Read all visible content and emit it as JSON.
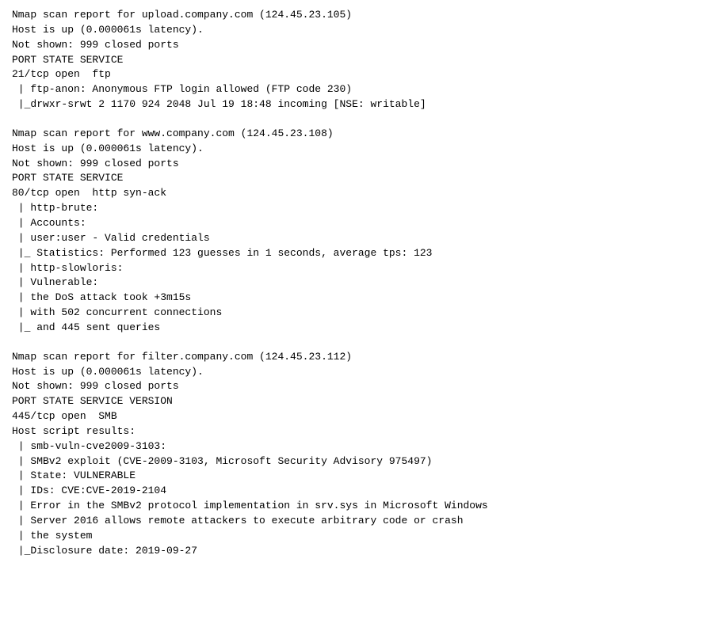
{
  "sections": [
    {
      "id": "section1",
      "lines": [
        "Nmap scan report for upload.company.com (124.45.23.105)",
        "Host is up (0.000061s latency).",
        "Not shown: 999 closed ports",
        "PORT STATE SERVICE",
        "21/tcp open  ftp",
        " | ftp-anon: Anonymous FTP login allowed (FTP code 230)",
        " |_drwxr-srwt 2 1170 924 2048 Jul 19 18:48 incoming [NSE: writable]"
      ]
    },
    {
      "id": "section2",
      "lines": [
        "Nmap scan report for www.company.com (124.45.23.108)",
        "Host is up (0.000061s latency).",
        "Not shown: 999 closed ports",
        "PORT STATE SERVICE",
        "80/tcp open  http syn-ack",
        " | http-brute:",
        " | Accounts:",
        " | user:user - Valid credentials",
        " |_ Statistics: Performed 123 guesses in 1 seconds, average tps: 123",
        " | http-slowloris:",
        " | Vulnerable:",
        " | the DoS attack took +3m15s",
        " | with 502 concurrent connections",
        " |_ and 445 sent queries"
      ]
    },
    {
      "id": "section3",
      "lines": [
        "Nmap scan report for filter.company.com (124.45.23.112)",
        "Host is up (0.000061s latency).",
        "Not shown: 999 closed ports",
        "PORT STATE SERVICE VERSION",
        "445/tcp open  SMB",
        "Host script results:",
        " | smb-vuln-cve2009-3103:",
        " | SMBv2 exploit (CVE-2009-3103, Microsoft Security Advisory 975497)",
        " | State: VULNERABLE",
        " | IDs: CVE:CVE-2019-2104",
        " | Error in the SMBv2 protocol implementation in srv.sys in Microsoft Windows",
        " | Server 2016 allows remote attackers to execute arbitrary code or crash",
        " | the system",
        " |_Disclosure date: 2019-09-27"
      ]
    }
  ]
}
